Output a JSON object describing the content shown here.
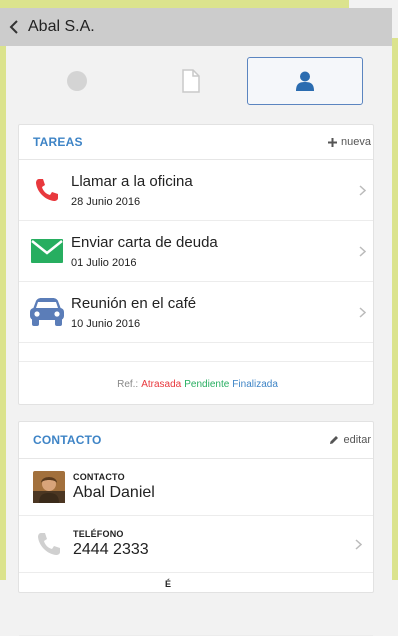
{
  "header": {
    "title": "Abal S.A.",
    "back_icon": "chevron-left-icon"
  },
  "tabs": [
    {
      "icon": "circle-icon",
      "active": false
    },
    {
      "icon": "document-icon",
      "active": false
    },
    {
      "icon": "user-icon",
      "active": true
    }
  ],
  "tasks_card": {
    "title": "TAREAS",
    "action_label": "nueva",
    "items": [
      {
        "title": "Llamar a la oficina",
        "date": "28 Junio 2016",
        "icon": "phone-icon",
        "color": "#e8383d"
      },
      {
        "title": "Enviar carta de deuda",
        "date": "01 Julio 2016",
        "icon": "envelope-icon",
        "color": "#27ae60"
      },
      {
        "title": "Reunión en el café",
        "date": "10 Junio 2016",
        "icon": "car-icon",
        "color": "#5b7db8"
      }
    ],
    "legend": {
      "prefix": "Ref.:",
      "late": "Atrasada",
      "pending": "Pendiente",
      "done": "Finalizada",
      "colors": {
        "late": "#e8383d",
        "pending": "#27ae60",
        "done": "#3e84c6"
      }
    }
  },
  "contact_card": {
    "title": "CONTACTO",
    "action_label": "editar",
    "rows": [
      {
        "label": "CONTACTO",
        "value": "Abal Daniel",
        "icon": "avatar"
      },
      {
        "label": "TELÉFONO",
        "value": "2444 2333",
        "icon": "phone-icon"
      },
      {
        "label": "É",
        "value": "",
        "icon": ""
      }
    ]
  },
  "colors": {
    "accent": "#3e84c6",
    "navbar": "#cccccc",
    "frame": "#dbe38d"
  }
}
